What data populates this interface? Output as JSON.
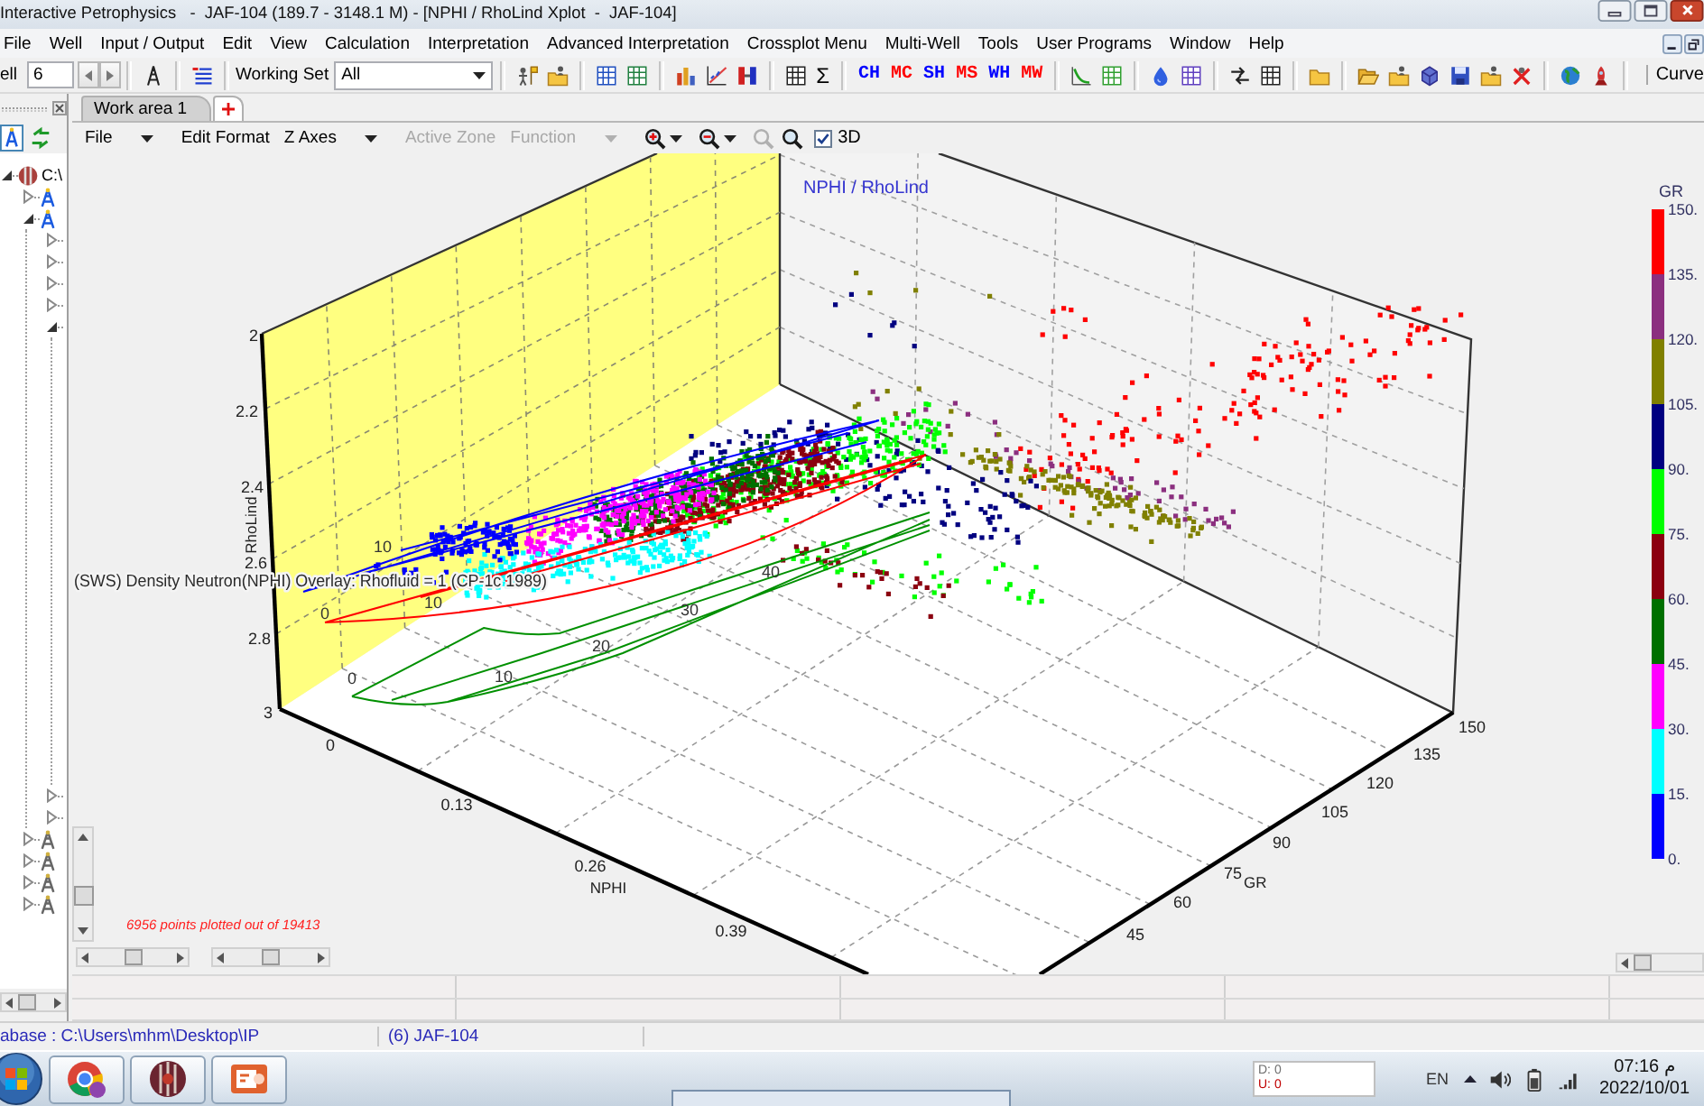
{
  "window": {
    "title": "Interactive Petrophysics   -  JAF-104 (189.7 - 3148.1 M) - [NPHI / RhoLind Xplot  -  JAF-104]"
  },
  "menu": [
    "File",
    "Well",
    "Input / Output",
    "Edit",
    "View",
    "Calculation",
    "Interpretation",
    "Advanced Interpretation",
    "Crossplot Menu",
    "Multi-Well",
    "Tools",
    "User Programs",
    "Window",
    "Help"
  ],
  "toolbar": {
    "well_label": "ell",
    "well_value": "6",
    "working_set_label": "Working Set",
    "working_set_value": "All",
    "sum_label": "Σ",
    "curve_buttons": [
      {
        "label": "CH",
        "color": "#0000ff"
      },
      {
        "label": "MC",
        "color": "#ff0000"
      },
      {
        "label": "SH",
        "color": "#0000ff"
      },
      {
        "label": "MS",
        "color": "#ff0000"
      },
      {
        "label": "WH",
        "color": "#0000ff"
      },
      {
        "label": "MW",
        "color": "#ff0000"
      }
    ],
    "curve_label": "Curve"
  },
  "side_panel": {
    "tree": [
      {
        "label": "C:\\",
        "expanded": true,
        "children": [
          {
            "active": true,
            "expanded": false
          },
          {
            "active": true,
            "expanded": true,
            "children": [
              {
                "expanded": false
              },
              {
                "expanded": false
              },
              {
                "expanded": false
              },
              {
                "expanded": false
              },
              {
                "expanded": true
              },
              {
                "expanded": false
              },
              {
                "expanded": false
              }
            ]
          },
          {
            "active": false,
            "expanded": false
          },
          {
            "active": false,
            "expanded": false
          },
          {
            "active": false,
            "expanded": false
          },
          {
            "active": false,
            "expanded": false
          }
        ]
      }
    ]
  },
  "tabs": [
    {
      "label": "Work area 1",
      "selected": true
    }
  ],
  "plot_toolbar": {
    "items": [
      {
        "label": "File",
        "disabled": false,
        "dropdown": true
      },
      {
        "label": "Edit Format",
        "disabled": false,
        "dropdown": false
      },
      {
        "label": "Z Axes",
        "disabled": false,
        "dropdown": true
      },
      {
        "label": "Active Zone",
        "disabled": true,
        "dropdown": false
      },
      {
        "label": "Function",
        "disabled": true,
        "dropdown": true
      }
    ],
    "zoom_tools": [
      {
        "disabled": false,
        "dropdown": true
      },
      {
        "disabled": false,
        "dropdown": true
      },
      {
        "disabled": true,
        "dropdown": false
      },
      {
        "disabled": false,
        "dropdown": false
      }
    ],
    "view_3d": {
      "label": "3D",
      "checked": true
    }
  },
  "plot": {
    "title": "NPHI / RhoLind",
    "y_axis": {
      "title": "RhoLind",
      "ticks": [
        "2",
        "2.2",
        "2.4",
        "2.6",
        "2.8",
        "3"
      ]
    },
    "x_axis": {
      "title": "NPHI",
      "ticks": [
        "0",
        "0.13",
        "0.26",
        "0.39"
      ]
    },
    "z_axis": {
      "title": "GR",
      "ticks": [
        "150",
        "135",
        "120",
        "105",
        "90",
        "75",
        "60",
        "45"
      ]
    },
    "overlay": {
      "title": "(SWS) Density Neutron(NPHI) Overlay: Rhofluid = 1 (CP-1c 1989)",
      "curves": [
        {
          "color": "#0000ff",
          "labels": [
            "10"
          ]
        },
        {
          "color": "#ff0000",
          "labels": [
            "0",
            "10"
          ]
        },
        {
          "color": "#009000",
          "labels": [
            "0",
            "10",
            "20",
            "30",
            "40"
          ]
        }
      ]
    },
    "legend": {
      "title": "GR",
      "ticks": [
        "150.",
        "135.",
        "120.",
        "105.",
        "90.",
        "75.",
        "60.",
        "45.",
        "30.",
        "15.",
        "0."
      ],
      "bands": [
        {
          "color": "#ff0000"
        },
        {
          "color": "#8b2f7f"
        },
        {
          "color": "#808000"
        },
        {
          "color": "#000080"
        },
        {
          "color": "#00ff00"
        },
        {
          "color": "#8b0010"
        },
        {
          "color": "#007000"
        },
        {
          "color": "#ff00ff"
        },
        {
          "color": "#00ffff"
        },
        {
          "color": "#0000ff"
        }
      ]
    },
    "footnote": "6956 points plotted out of 19413"
  },
  "status_bar": {
    "database": "abase : C:\\Users\\mhm\\Desktop\\IP",
    "well": "(6) JAF-104"
  },
  "taskbar": {
    "counters": [
      {
        "label": "D: 0",
        "color": "#707070"
      },
      {
        "label": "U: 0",
        "color": "#c00000"
      }
    ],
    "language": "EN",
    "time": "07:16 م",
    "date": "2022/10/01"
  }
}
